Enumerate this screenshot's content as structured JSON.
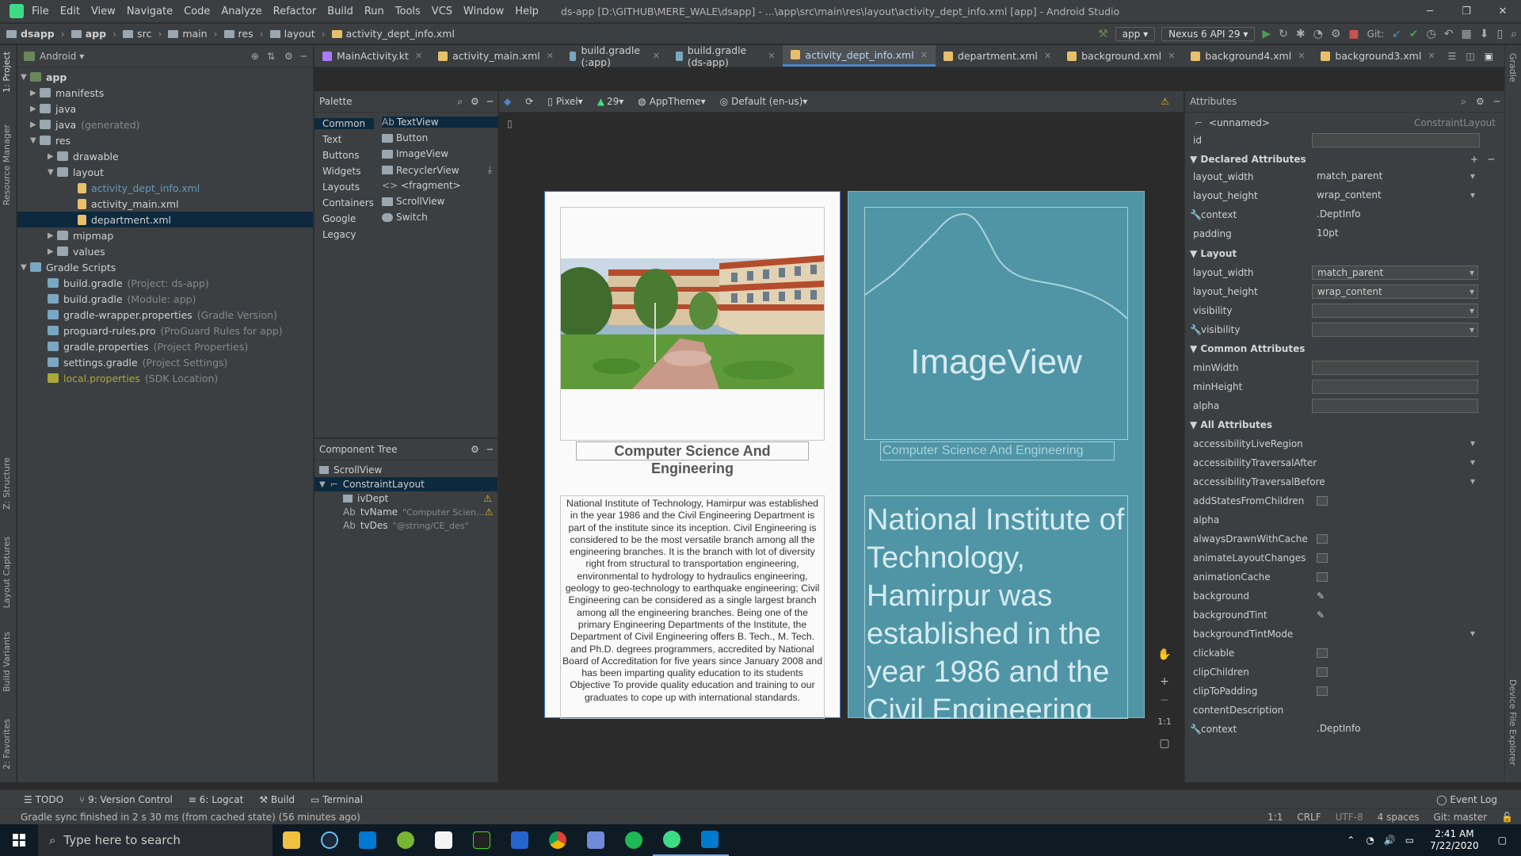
{
  "window": {
    "menu": [
      "File",
      "Edit",
      "View",
      "Navigate",
      "Code",
      "Analyze",
      "Refactor",
      "Build",
      "Run",
      "Tools",
      "VCS",
      "Window",
      "Help"
    ],
    "title": "ds-app [D:\\GITHUB\\MERE_WALE\\dsapp] - ...\\app\\src\\main\\res\\layout\\activity_dept_info.xml [app] - Android Studio"
  },
  "breadcrumb": [
    "dsapp",
    "app",
    "src",
    "main",
    "res",
    "layout",
    "activity_dept_info.xml"
  ],
  "toolbar": {
    "run_config": "app",
    "device": "Nexus 6 API 29",
    "git_label": "Git:"
  },
  "project_panel": {
    "view_mode": "Android",
    "items": [
      {
        "label": "app",
        "note": ""
      },
      {
        "label": "manifests",
        "note": ""
      },
      {
        "label": "java",
        "note": ""
      },
      {
        "label": "java",
        "note": "(generated)"
      },
      {
        "label": "res",
        "note": ""
      },
      {
        "label": "drawable",
        "note": ""
      },
      {
        "label": "layout",
        "note": ""
      },
      {
        "label": "activity_dept_info.xml",
        "note": ""
      },
      {
        "label": "activity_main.xml",
        "note": ""
      },
      {
        "label": "department.xml",
        "note": ""
      },
      {
        "label": "mipmap",
        "note": ""
      },
      {
        "label": "values",
        "note": ""
      },
      {
        "label": "Gradle Scripts",
        "note": ""
      },
      {
        "label": "build.gradle",
        "note": "(Project: ds-app)"
      },
      {
        "label": "build.gradle",
        "note": "(Module: app)"
      },
      {
        "label": "gradle-wrapper.properties",
        "note": "(Gradle Version)"
      },
      {
        "label": "proguard-rules.pro",
        "note": "(ProGuard Rules for app)"
      },
      {
        "label": "gradle.properties",
        "note": "(Project Properties)"
      },
      {
        "label": "settings.gradle",
        "note": "(Project Settings)"
      },
      {
        "label": "local.properties",
        "note": "(SDK Location)"
      }
    ]
  },
  "editor_tabs": [
    "MainActivity.kt",
    "activity_main.xml",
    "build.gradle (:app)",
    "build.gradle (ds-app)",
    "activity_dept_info.xml",
    "department.xml",
    "background.xml",
    "background4.xml",
    "background3.xml"
  ],
  "active_tab_index": 4,
  "palette": {
    "title": "Palette",
    "categories": [
      "Common",
      "Text",
      "Buttons",
      "Widgets",
      "Layouts",
      "Containers",
      "Google",
      "Legacy"
    ],
    "items": [
      {
        "icon": "Ab",
        "label": "TextView"
      },
      {
        "icon": "",
        "label": "Button"
      },
      {
        "icon": "",
        "label": "ImageView"
      },
      {
        "icon": "",
        "label": "RecyclerView"
      },
      {
        "icon": "<>",
        "label": "<fragment>"
      },
      {
        "icon": "",
        "label": "ScrollView"
      },
      {
        "icon": "",
        "label": "Switch"
      }
    ]
  },
  "component_tree": {
    "title": "Component Tree",
    "items": [
      {
        "label": "ScrollView",
        "detail": ""
      },
      {
        "label": "ConstraintLayout",
        "detail": ""
      },
      {
        "label": "ivDept",
        "detail": ""
      },
      {
        "label": "tvName",
        "detail": "\"Computer Scien..."
      },
      {
        "label": "tvDes",
        "detail": "\"@string/CE_des\""
      }
    ]
  },
  "design_toolbar": {
    "device": "Pixel",
    "api": "29",
    "theme": "AppTheme",
    "locale": "Default (en-us)"
  },
  "preview": {
    "dept_name": "Computer Science And Engineering",
    "description": "National Institute of Technology, Hamirpur was established in the year 1986 and the Civil Engineering Department is part of the institute since its inception. Civil Engineering is considered to be the most versatile branch among all the engineering branches. It is the branch with lot of diversity right from structural to transportation engineering, environmental to hydrology to hydraulics engineering, geology to geo-technology to earthquake engineering; Civil Engineering can be considered as a single largest branch among all the engineering branches. Being one of the primary Engineering Departments of the Institute, the Department of Civil Engineering offers B. Tech., M. Tech. and Ph.D. degrees programmers, accredited by National Board of Accreditation for five years since January 2008 and has been imparting quality education to its students Objective To provide quality education and training to our graduates to cope up with international standards.",
    "blueprint_image_label": "ImageView",
    "blueprint_desc": "National Institute of Technology, Hamirpur was established in the year 1986 and the Civil Engineering"
  },
  "attributes": {
    "title": "Attributes",
    "component": "<unnamed>",
    "component_type": "ConstraintLayout",
    "id_label": "id",
    "declared_title": "Declared Attributes",
    "declared": [
      {
        "name": "layout_width",
        "value": "match_parent"
      },
      {
        "name": "layout_height",
        "value": "wrap_content"
      },
      {
        "name": "context",
        "value": ".DeptInfo"
      },
      {
        "name": "padding",
        "value": "10pt"
      }
    ],
    "layout_title": "Layout",
    "layout": [
      {
        "name": "layout_width",
        "value": "match_parent"
      },
      {
        "name": "layout_height",
        "value": "wrap_content"
      },
      {
        "name": "visibility",
        "value": ""
      },
      {
        "name": "visibility",
        "value": ""
      }
    ],
    "common_title": "Common Attributes",
    "common": [
      {
        "name": "minWidth",
        "value": ""
      },
      {
        "name": "minHeight",
        "value": ""
      },
      {
        "name": "alpha",
        "value": ""
      }
    ],
    "all_title": "All Attributes",
    "all": [
      {
        "name": "accessibilityLiveRegion",
        "value": ""
      },
      {
        "name": "accessibilityTraversalAfter",
        "value": ""
      },
      {
        "name": "accessibilityTraversalBefore",
        "value": ""
      },
      {
        "name": "addStatesFromChildren",
        "value": ""
      },
      {
        "name": "alpha",
        "value": ""
      },
      {
        "name": "alwaysDrawnWithCache",
        "value": ""
      },
      {
        "name": "animateLayoutChanges",
        "value": ""
      },
      {
        "name": "animationCache",
        "value": ""
      },
      {
        "name": "background",
        "value": ""
      },
      {
        "name": "backgroundTint",
        "value": ""
      },
      {
        "name": "backgroundTintMode",
        "value": ""
      },
      {
        "name": "clickable",
        "value": ""
      },
      {
        "name": "clipChildren",
        "value": ""
      },
      {
        "name": "clipToPadding",
        "value": ""
      },
      {
        "name": "contentDescription",
        "value": ""
      },
      {
        "name": "context",
        "value": ".DeptInfo"
      }
    ]
  },
  "bottom_tools": [
    "TODO",
    "9: Version Control",
    "6: Logcat",
    "Build",
    "Terminal"
  ],
  "event_log": "Event Log",
  "status": {
    "message": "Gradle sync finished in 2 s 30 ms (from cached state) (56 minutes ago)",
    "position": "1:1",
    "line_sep": "CRLF",
    "encoding": "UTF-8",
    "indent": "4 spaces",
    "git": "Git: master"
  },
  "taskbar": {
    "search_placeholder": "Type here to search",
    "time": "2:41 AM",
    "date": "7/22/2020"
  },
  "side_tabs": {
    "left": [
      "1: Project",
      "Resource Manager",
      "Z: Structure",
      "Layout Captures",
      "Build Variants",
      "2: Favorites"
    ],
    "right": [
      "Gradle",
      "Device File Explorer"
    ]
  }
}
